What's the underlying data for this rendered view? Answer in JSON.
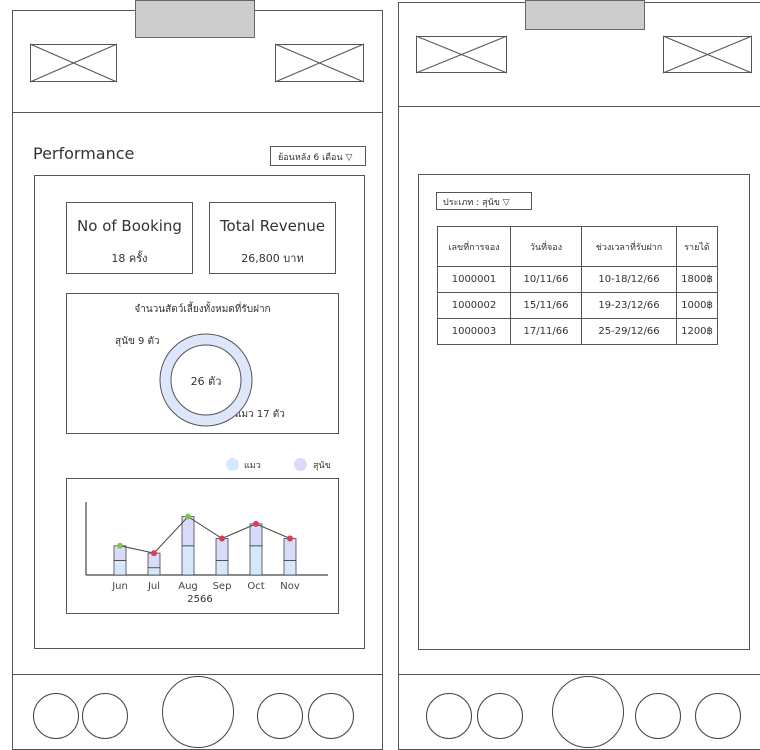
{
  "left": {
    "title": "Performance",
    "period_dropdown": "ย้อนหลัง 6 เดือน ▽",
    "booking_card": {
      "title": "No of Booking",
      "value": "18 ครั้ง"
    },
    "revenue_card": {
      "title": "Total Revenue",
      "value": "26,800 บาท"
    },
    "pets_card": {
      "title": "จำนวนสัตว์เลี้ยงทั้งหมดที่รับฝาก",
      "total": "26 ตัว",
      "dog_label": "สุนัข 9 ตัว",
      "cat_label": "แมว 17 ตัว"
    },
    "legend": {
      "cat": "แมว",
      "dog": "สุนัข"
    },
    "colors": {
      "cat": "#d6e8fb",
      "dog": "#d8dcfa",
      "peak": "#7cc44c",
      "low": "#e03a4b"
    }
  },
  "chart_data": {
    "type": "bar",
    "categories": [
      "Jun",
      "Jul",
      "Aug",
      "Sep",
      "Oct",
      "Nov"
    ],
    "xlabel": "2566",
    "series": [
      {
        "name": "แมว",
        "values": [
          2,
          1,
          4,
          2,
          4,
          2
        ]
      },
      {
        "name": "สุนัข",
        "values": [
          2,
          2,
          4,
          3,
          3,
          3
        ]
      }
    ],
    "ylim": [
      0,
      10
    ]
  },
  "right": {
    "type_filter": "ประเภท : สุนัข ▽",
    "table": {
      "headers": [
        "เลขที่การจอง",
        "วันที่จอง",
        "ช่วงเวลาที่รับฝาก",
        "รายได้"
      ],
      "rows": [
        [
          "1000001",
          "10/11/66",
          "10-18/12/66",
          "1800฿"
        ],
        [
          "1000002",
          "15/11/66",
          "19-23/12/66",
          "1000฿"
        ],
        [
          "1000003",
          "17/11/66",
          "25-29/12/66",
          "1200฿"
        ]
      ]
    }
  }
}
